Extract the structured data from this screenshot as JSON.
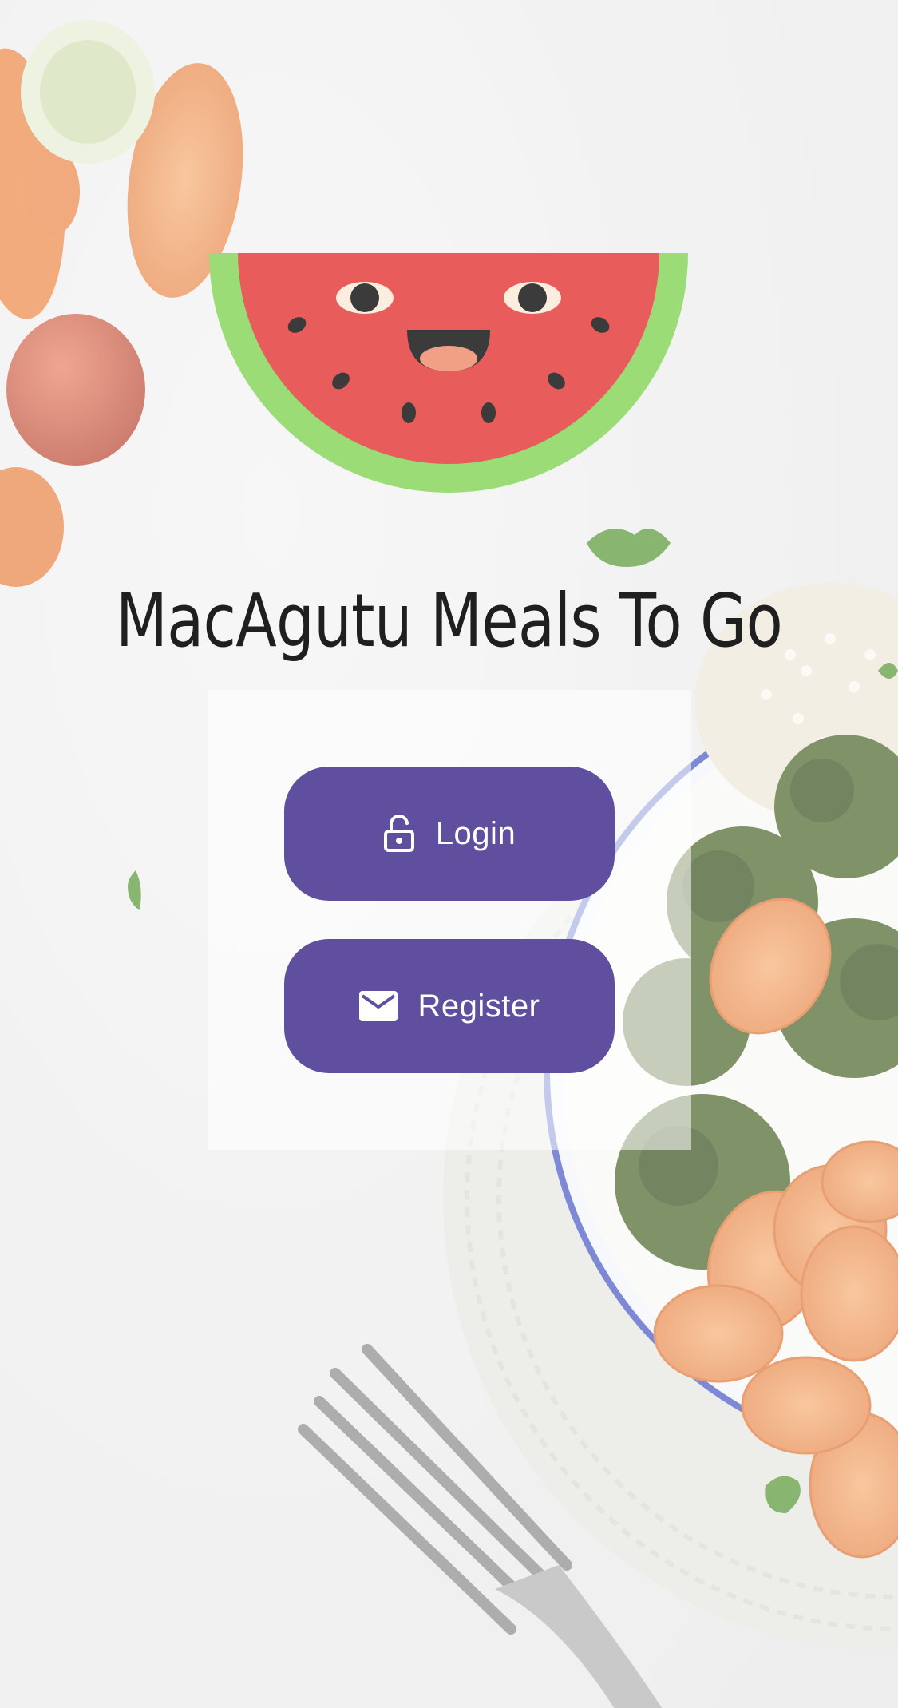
{
  "app": {
    "title": "MacAgutu Meals To Go"
  },
  "auth": {
    "login_label": "Login",
    "login_icon": "lock-open-icon",
    "register_label": "Register",
    "register_icon": "mail-icon"
  },
  "colors": {
    "button": "#5f4f9e",
    "button_text": "#ffffff",
    "watermelon_flesh": "#e85c5c",
    "watermelon_rind": "#9bdc77"
  }
}
